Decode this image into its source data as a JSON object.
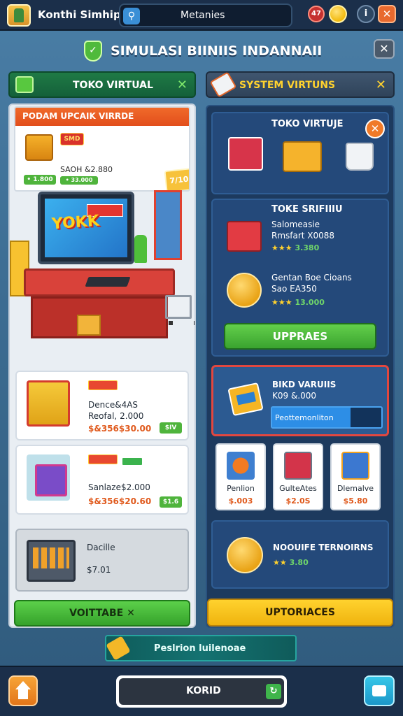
{
  "topbar": {
    "title": "Konthi Simhips",
    "search_text": "Metanies",
    "badge_count": "47",
    "info_icon": "info-icon",
    "close_icon": "close-icon"
  },
  "header": {
    "title": "SIMULASI BIINIIS INDANNAII",
    "shield_icon": "shield-icon",
    "close_icon": "close-icon"
  },
  "left": {
    "tab_label": "TOKO VIRTUAL",
    "promo": {
      "heading": "PODAM UPCAIK VIRRDE",
      "tag": "SMD",
      "price": "SAOH &2.880",
      "chip1": "• 1.800",
      "chip2": "• 33.000",
      "sticker": "7/10"
    },
    "monitor_title": "YOKK",
    "cards": [
      {
        "name": "Dence&4AS",
        "name2": "Reofal, 2.000",
        "price": "$&356$30.00",
        "chip": "$IV"
      },
      {
        "name": "Sanlaze$2.000",
        "price": "$&356$20.60",
        "chip": "$1.6"
      }
    ],
    "gray_card": {
      "name": "Dacille",
      "price": "$7.01"
    },
    "button": "VOITTABE ✕"
  },
  "right": {
    "tab_label": "SYSTEM VIRTUNS",
    "featured": {
      "title": "TOKO VIRTUJE"
    },
    "list": {
      "title": "TOKE SRIFIIIU",
      "item1_line1": "Salomeasie",
      "item1_line2": "Rmsfart X0088",
      "item1_stars": "★★★",
      "item1_value": "3.380",
      "item2_line1": "Gentan Boe Cioans",
      "item2_line2": "Sao EA350",
      "item2_stars": "★★★",
      "item2_value": "13.000"
    },
    "upgrade_button": "UPPRAES",
    "highlight": {
      "line1": "BIKD VARUIIS",
      "line2": "K09 &.000",
      "bar_text": "Peottemonliton",
      "progress": 0.72
    },
    "tiles": [
      {
        "name": "Penlion",
        "price": "$.003"
      },
      {
        "name": "GulteAtes",
        "price": "$2.0S"
      },
      {
        "name": "Dlemalve",
        "price": "$5.80"
      }
    ],
    "bottom_item": {
      "name": "NOOUIFE TERNOIRNS",
      "stars": "★★",
      "value": "3.80"
    },
    "bottom_button": "UPTORIACES"
  },
  "banner": {
    "text": "Peslrion luilenoae"
  },
  "bottombar": {
    "field_text": "KORID",
    "home_icon": "home-icon",
    "chat_icon": "chat-icon"
  },
  "colors": {
    "accent_green": "#4fb43c",
    "accent_orange": "#e8692e",
    "accent_yellow": "#ffd22e",
    "panel_navy": "#1d3a5e"
  }
}
